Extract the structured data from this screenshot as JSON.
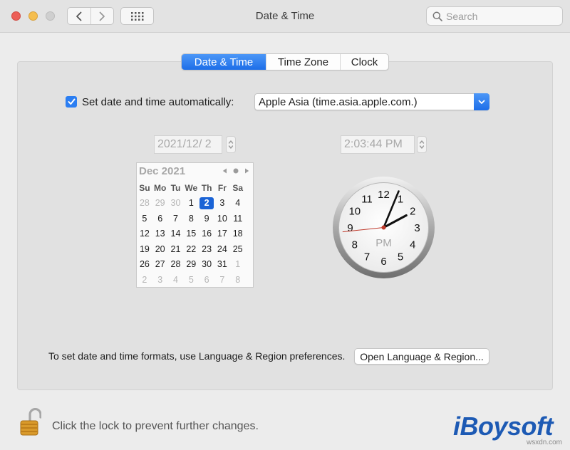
{
  "window": {
    "title": "Date & Time"
  },
  "search": {
    "placeholder": "Search"
  },
  "tabs": [
    {
      "label": "Date & Time",
      "active": true
    },
    {
      "label": "Time Zone",
      "active": false
    },
    {
      "label": "Clock",
      "active": false
    }
  ],
  "auto": {
    "label": "Set date and time automatically:",
    "checked": true,
    "server": "Apple Asia (time.asia.apple.com.)"
  },
  "date_field": "2021/12/  2",
  "time_field": "2:03:44 PM",
  "calendar": {
    "month": "Dec 2021",
    "weekdays": [
      "Su",
      "Mo",
      "Tu",
      "We",
      "Th",
      "Fr",
      "Sa"
    ],
    "weeks": [
      [
        "28",
        "29",
        "30",
        "1",
        "2",
        "3",
        "4"
      ],
      [
        "5",
        "6",
        "7",
        "8",
        "9",
        "10",
        "11"
      ],
      [
        "12",
        "13",
        "14",
        "15",
        "16",
        "17",
        "18"
      ],
      [
        "19",
        "20",
        "21",
        "22",
        "23",
        "24",
        "25"
      ],
      [
        "26",
        "27",
        "28",
        "29",
        "30",
        "31",
        "1"
      ],
      [
        "2",
        "3",
        "4",
        "5",
        "6",
        "7",
        "8"
      ]
    ],
    "selected": "2"
  },
  "clock": {
    "ampm": "PM",
    "numbers": [
      "12",
      "1",
      "2",
      "3",
      "4",
      "5",
      "6",
      "7",
      "8",
      "9",
      "10",
      "11"
    ],
    "hour": 2,
    "minute": 3,
    "second": 44
  },
  "formats_text": "To set date and time formats, use Language & Region preferences.",
  "open_button": "Open Language & Region...",
  "lock_text": "Click the lock to prevent further changes.",
  "brand": "iBoysoft",
  "watermark": "wsxdn.com",
  "colors": {
    "accent": "#1d6ee8",
    "brand": "#1d5ab4",
    "second_hand": "#c0392b"
  }
}
